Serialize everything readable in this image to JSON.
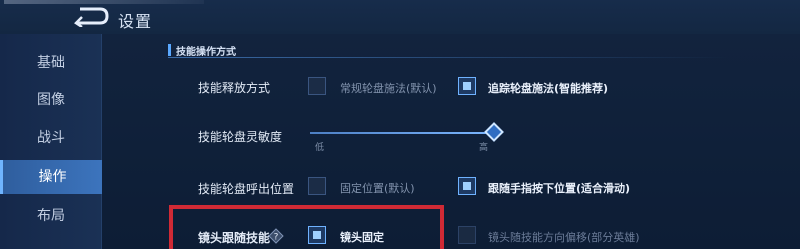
{
  "header": {
    "title": "设置",
    "back_icon": "back-arrow-icon"
  },
  "sidebar": {
    "items": [
      {
        "label": "基础",
        "active": false
      },
      {
        "label": "图像",
        "active": false
      },
      {
        "label": "战斗",
        "active": false
      },
      {
        "label": "操作",
        "active": true
      },
      {
        "label": "布局",
        "active": false
      }
    ]
  },
  "section": {
    "title": "技能操作方式"
  },
  "rows": {
    "cast_mode": {
      "label": "技能释放方式",
      "option1": {
        "label": "常规轮盘施法(默认)",
        "checked": false
      },
      "option2": {
        "label": "追踪轮盘施法(智能推荐)",
        "checked": true
      }
    },
    "sensitivity": {
      "label": "技能轮盘灵敏度",
      "low_label": "低",
      "high_label": "高",
      "value": 1.0
    },
    "wheel_position": {
      "label": "技能轮盘呼出位置",
      "option1": {
        "label": "固定位置(默认)",
        "checked": false
      },
      "option2": {
        "label": "跟随手指按下位置(适合滑动)",
        "checked": true
      }
    },
    "camera_follow": {
      "label": "镜头跟随技能",
      "help_icon": "question-mark-icon",
      "option1": {
        "label": "镜头固定",
        "checked": true
      },
      "option2": {
        "label": "镜头随技能方向偏移(部分英雄)",
        "checked": false
      }
    }
  },
  "colors": {
    "accent": "#5aa8ff",
    "active_tab": "#3c74bd",
    "highlight_border": "#d02a35"
  }
}
